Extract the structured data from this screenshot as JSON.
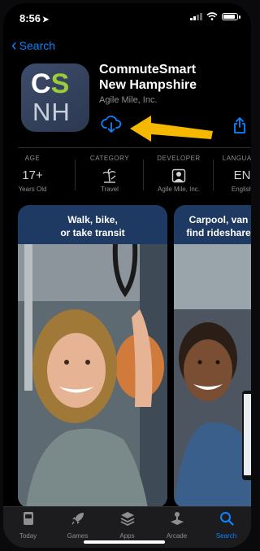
{
  "status_bar": {
    "time": "8:56",
    "location_arrow": "location-arrow-icon",
    "battery_level": 0.9
  },
  "nav": {
    "back_label": "Search"
  },
  "app": {
    "icon_top": "CS",
    "icon_top_c": "C",
    "icon_top_s": "S",
    "icon_bottom": "NH",
    "name_line1": "CommuteSmart",
    "name_line2": "New Hampshire",
    "developer": "Agile Mile, Inc."
  },
  "info": [
    {
      "header": "AGE",
      "value": "17+",
      "sub": "Years Old"
    },
    {
      "header": "CATEGORY",
      "icon": "travel-icon",
      "sub": "Travel"
    },
    {
      "header": "DEVELOPER",
      "icon": "person-icon",
      "sub": "Agile Mile, Inc."
    },
    {
      "header": "LANGUAGE",
      "value": "EN",
      "sub": "English"
    }
  ],
  "screenshots": [
    {
      "caption_line1": "Walk, bike,",
      "caption_line2": "or take transit"
    },
    {
      "caption_line1": "Carpool, van",
      "caption_line2": "find rideshare"
    }
  ],
  "tabs": [
    {
      "label": "Today",
      "icon": "today-icon",
      "active": false
    },
    {
      "label": "Games",
      "icon": "rocket-icon",
      "active": false
    },
    {
      "label": "Apps",
      "icon": "layers-icon",
      "active": false
    },
    {
      "label": "Arcade",
      "icon": "joystick-icon",
      "active": false
    },
    {
      "label": "Search",
      "icon": "search-icon",
      "active": true
    }
  ],
  "colors": {
    "accent": "#0a84ff",
    "annotation_arrow": "#f5b800",
    "icon_bg": "#34425e",
    "icon_s": "#9acd3a"
  }
}
